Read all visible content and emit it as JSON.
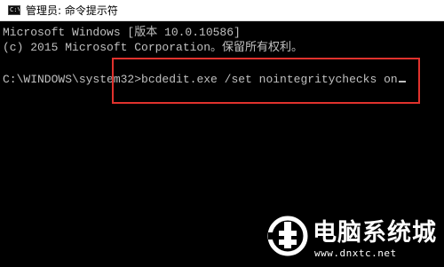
{
  "window": {
    "title": "管理员: 命令提示符",
    "icon": "cmd-icon",
    "icon_glyph": "C:\\"
  },
  "console": {
    "lines": [
      "Microsoft Windows [版本 10.0.10586]",
      "(c) 2015 Microsoft Corporation。保留所有权利。",
      "",
      "C:\\WINDOWS\\system32>bcdedit.exe /set nointegritychecks on"
    ],
    "prompt": "C:\\WINDOWS\\system32>",
    "command": "bcdedit.exe /set nointegritychecks on"
  },
  "annotation": {
    "color": "#e0322d"
  },
  "watermark": {
    "brand": "电脑系统城",
    "url": "www.dnxtc.net",
    "icon": "watermark-logo-icon"
  },
  "colors": {
    "console_bg": "#000000",
    "console_text": "#c0c0c0",
    "titlebar_bg": "#ffffff"
  }
}
